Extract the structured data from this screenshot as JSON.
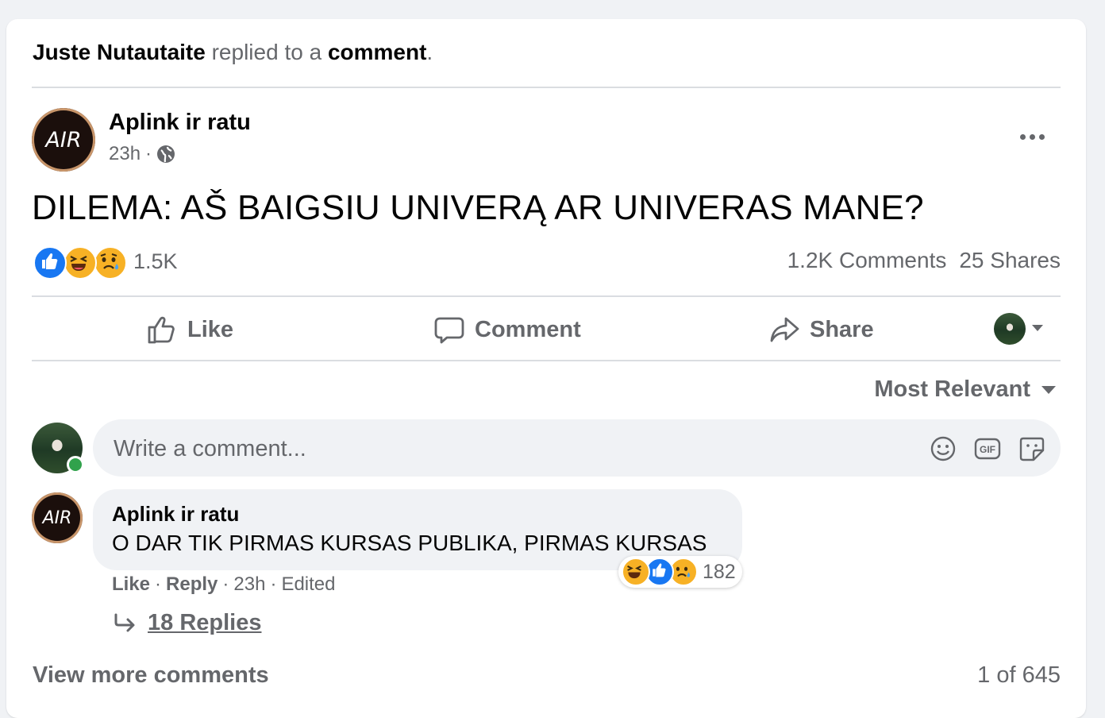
{
  "activity": {
    "actor": "Juste Nutautaite",
    "verb": "replied to a",
    "object": "comment",
    "period": "."
  },
  "post": {
    "page_name": "Aplink ir ratu",
    "avatar_text": "AIR",
    "time": "23h",
    "separator": "·",
    "privacy_icon": "globe-icon",
    "text": "DILEMA: AŠ BAIGSIU UNIVERĄ AR UNIVERAS MANE?",
    "reactions": [
      "like",
      "haha",
      "sad"
    ],
    "reaction_count": "1.5K",
    "comments_count": "1.2K Comments",
    "shares_count": "25 Shares"
  },
  "actions": {
    "like": "Like",
    "comment": "Comment",
    "share": "Share"
  },
  "sort": {
    "label": "Most Relevant"
  },
  "composer": {
    "placeholder": "Write a comment...",
    "icons": [
      "emoji-icon",
      "gif-icon",
      "sticker-icon"
    ]
  },
  "comment": {
    "author": "Aplink ir ratu",
    "avatar_text": "AIR",
    "text": "O DAR TIK PIRMAS KURSAS PUBLIKA, PIRMAS KURSAS",
    "reactions": [
      "haha",
      "like",
      "sad"
    ],
    "reaction_count": "182",
    "like": "Like",
    "reply": "Reply",
    "time": "23h",
    "edited": "Edited",
    "sep": "·",
    "replies": "18 Replies"
  },
  "footer": {
    "view_more": "View more comments",
    "pager": "1 of 645"
  },
  "colors": {
    "like_blue": "#1877f2",
    "haha_yellow": "#f7b125",
    "muted_text": "#65676b",
    "online_green": "#31a24c"
  }
}
